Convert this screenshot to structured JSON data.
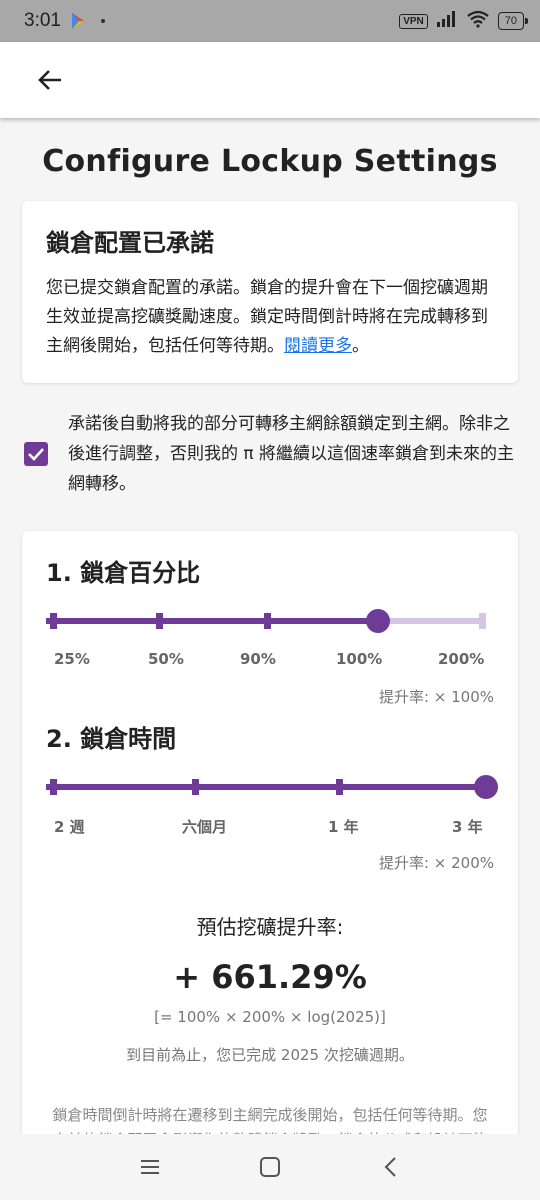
{
  "status_bar": {
    "time": "3:01",
    "vpn": "VPN",
    "battery": "70"
  },
  "header": {
    "title": "Configure Lockup Settings"
  },
  "commitment": {
    "title": "鎖倉配置已承諾",
    "text": "您已提交鎖倉配置的承諾。鎖倉的提升會在下一個挖礦週期生效並提高挖礦獎勵速度。鎖定時間倒計時將在完成轉移到主網後開始，包括任何等待期。",
    "link": "閱讀更多",
    "suffix": "。"
  },
  "auto_lock": {
    "checked": true,
    "text": "承諾後自動將我的部分可轉移主網餘額鎖定到主網。除非之後進行調整，否則我的 π 將繼續以這個速率鎖倉到未來的主網轉移。"
  },
  "lockup_percentage": {
    "title": "1. 鎖倉百分比",
    "options": [
      "25%",
      "50%",
      "90%",
      "100%",
      "200%"
    ],
    "selected": "100%",
    "boost_label": "提升率: × 100%"
  },
  "lockup_duration": {
    "title": "2. 鎖倉時間",
    "options": [
      "2 週",
      "六個月",
      "1 年",
      "3 年"
    ],
    "selected": "3 年",
    "boost_label": "提升率: × 200%"
  },
  "estimate": {
    "label": "預估挖礦提升率:",
    "value": "+ 661.29%",
    "formula": "[= 100% × 200% × log(2025)]",
    "cycles": "到目前為止，您已完成 2025 次挖礦週期。",
    "note": "鎖倉時間倒計時將在遷移到主網完成後開始，包括任何等待期。您之前的鎖倉配置會影響您的整體鎖倉獎勵，鎖倉的公式和設計可能會有些微的變化。"
  },
  "colors": {
    "accent": "#6e3c96",
    "accent_light": "#d6c6e3",
    "link": "#1a73e8"
  },
  "icons": [
    "play-store-icon",
    "back-arrow-icon",
    "signal-icon",
    "wifi-icon",
    "menu-icon",
    "home-icon",
    "back-nav-icon",
    "check-icon"
  ]
}
